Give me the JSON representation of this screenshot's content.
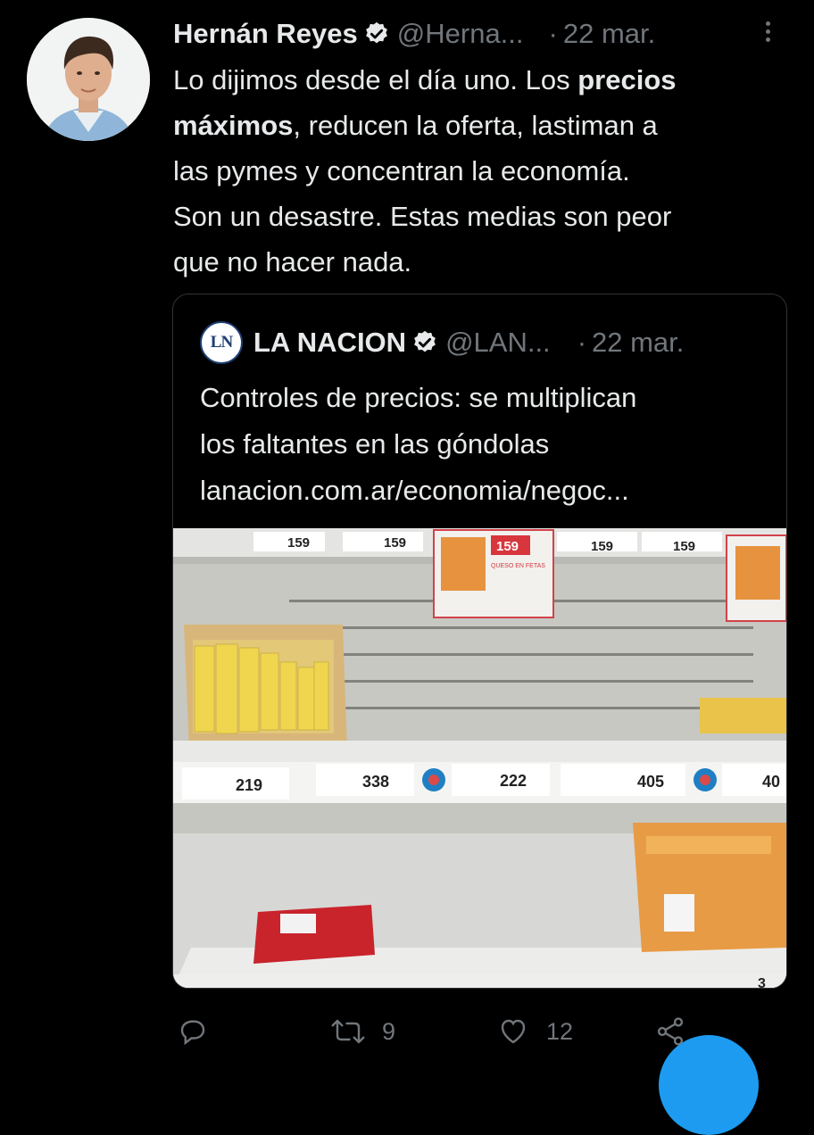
{
  "tweet": {
    "author_name": "Hernán Reyes",
    "handle": "@Herna...",
    "separator": "·",
    "time": "22 mar.",
    "text_lines": [
      {
        "before": "Lo dijimos desde el día uno. Los ",
        "bold": "precios",
        "after": ""
      },
      {
        "before": "",
        "bold": "máximos",
        "after": ", reducen la oferta, lastiman a"
      },
      {
        "before": "las pymes y concentran la economía.",
        "bold": "",
        "after": ""
      },
      {
        "before": "Son un desastre. Estas medias son peor",
        "bold": "",
        "after": ""
      },
      {
        "before": "que no hacer nada.",
        "bold": "",
        "after": ""
      }
    ]
  },
  "quote": {
    "logo_text": "LN",
    "author_name": "LA NACION",
    "handle": "@LAN...",
    "separator": "·",
    "time": "22 mar.",
    "text_lines": [
      "Controles de precios: se multiplican",
      "los faltantes en las góndolas",
      "lanacion.com.ar/economia/negoc..."
    ],
    "photo_labels": {
      "top_prices": [
        "159",
        "159",
        "159",
        "159"
      ],
      "promo_price": "159",
      "promo_text": "QUESO EN FETAS",
      "mid_prices": [
        "219",
        "338",
        "222",
        "405",
        "40"
      ],
      "bottom_price": "3"
    }
  },
  "actions": {
    "retweet_count": "9",
    "like_count": "12"
  },
  "colors": {
    "background": "#000000",
    "text": "#e7e9ea",
    "muted": "#71767b",
    "verified": "#e7e9ea",
    "accent": "#1d9bf0"
  }
}
